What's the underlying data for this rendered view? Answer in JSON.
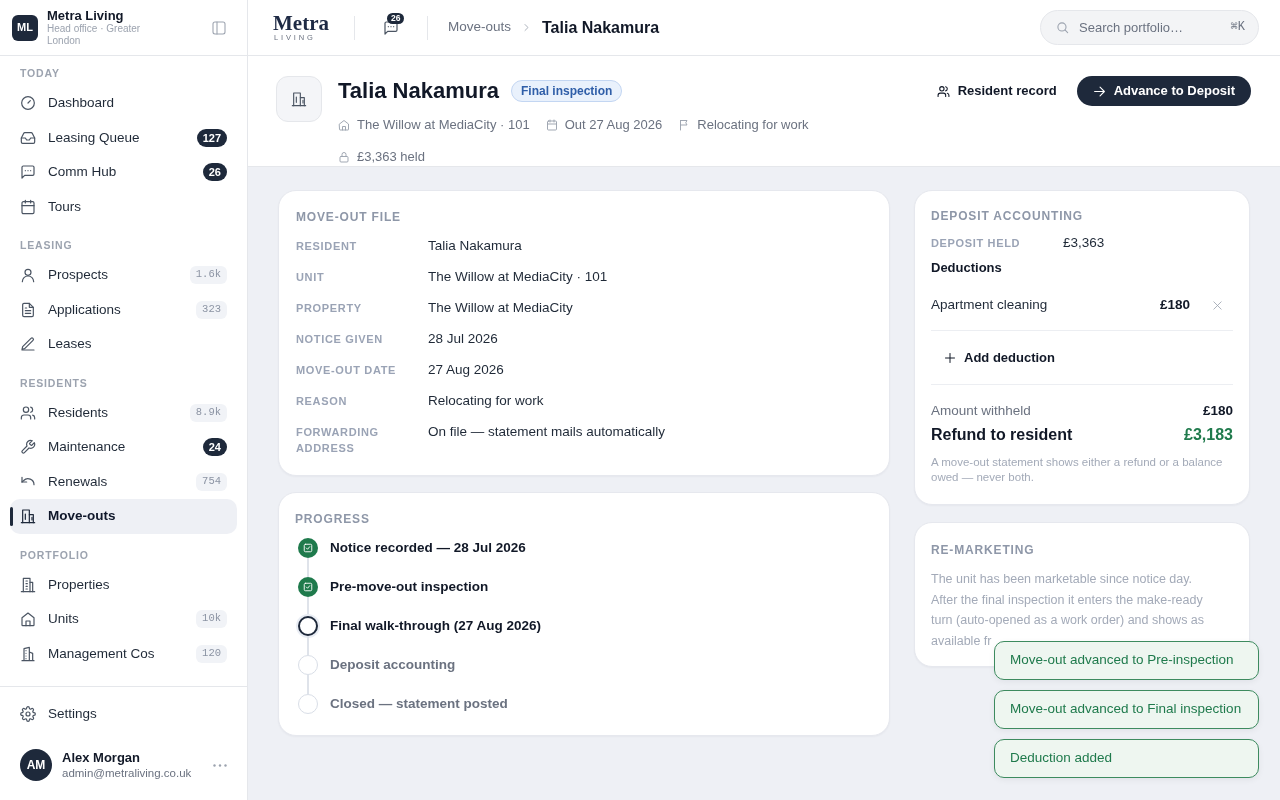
{
  "sidebar": {
    "brand": {
      "initials": "ML",
      "name": "Metra Living",
      "subtitle": "Head office · Greater London"
    },
    "sections": [
      {
        "label": "TODAY",
        "items": [
          {
            "label": "Dashboard",
            "selected": false
          },
          {
            "label": "Leasing Queue",
            "selected": false,
            "badge": {
              "text": "127",
              "kind": "unread"
            }
          },
          {
            "label": "Comm Hub",
            "selected": false,
            "badge": {
              "text": "26",
              "kind": "unread"
            }
          },
          {
            "label": "Tours",
            "selected": false
          }
        ]
      },
      {
        "label": "LEASING",
        "items": [
          {
            "label": "Prospects",
            "selected": false,
            "badge": {
              "text": "1.6k",
              "kind": "total"
            }
          },
          {
            "label": "Applications",
            "selected": false,
            "badge": {
              "text": "323",
              "kind": "total"
            }
          },
          {
            "label": "Leases",
            "selected": false
          }
        ]
      },
      {
        "label": "RESIDENTS",
        "items": [
          {
            "label": "Residents",
            "selected": false,
            "badge": {
              "text": "8.9k",
              "kind": "total"
            }
          },
          {
            "label": "Maintenance",
            "selected": false,
            "badge": {
              "text": "24",
              "kind": "unread"
            }
          },
          {
            "label": "Renewals",
            "selected": false,
            "badge": {
              "text": "754",
              "kind": "total"
            }
          },
          {
            "label": "Move-outs",
            "selected": true
          }
        ]
      },
      {
        "label": "PORTFOLIO",
        "items": [
          {
            "label": "Properties",
            "selected": false
          },
          {
            "label": "Units",
            "selected": false,
            "badge": {
              "text": "10k",
              "kind": "total"
            }
          },
          {
            "label": "Management Cos",
            "selected": false,
            "badge": {
              "text": "120",
              "kind": "total"
            }
          }
        ]
      }
    ],
    "settings": {
      "label": "Settings",
      "selected": false
    },
    "user": {
      "initials": "AM",
      "name": "Alex Morgan",
      "email": "admin@metraliving.co.uk"
    }
  },
  "top_bar": {
    "logo": {
      "name": "Metra",
      "tagline": "LIVING"
    },
    "messages_badge": "26",
    "breadcrumb": [
      "Move-outs",
      "Talia Nakamura"
    ],
    "search": {
      "placeholder": "Search portfolio…",
      "shortcut": "⌘K"
    }
  },
  "record_header": {
    "name": "Talia Nakamura",
    "status": "Final inspection",
    "meta": [
      "The Willow at MediaCity · 101",
      "Out 27 Aug 2026",
      "Relocating for work",
      "£3,363 held"
    ],
    "actions": [
      {
        "label": "Resident record",
        "kind": "secondary"
      },
      {
        "label": "Advance to Deposit",
        "kind": "primary"
      }
    ]
  },
  "move_out_file": {
    "title": "MOVE-OUT FILE",
    "rows": [
      {
        "label": "RESIDENT",
        "value": "Talia Nakamura"
      },
      {
        "label": "UNIT",
        "value": "The Willow at MediaCity · 101"
      },
      {
        "label": "PROPERTY",
        "value": "The Willow at MediaCity"
      },
      {
        "label": "NOTICE GIVEN",
        "value": "28 Jul 2026"
      },
      {
        "label": "MOVE-OUT DATE",
        "value": "27 Aug 2026"
      },
      {
        "label": "REASON",
        "value": "Relocating for work"
      },
      {
        "label": "FORWARDING ADDRESS",
        "value": "On file — statement mails automatically"
      }
    ]
  },
  "progress": {
    "title": "PROGRESS",
    "steps": [
      {
        "label": "Notice recorded — 28 Jul 2026",
        "done": true,
        "current": false
      },
      {
        "label": "Pre-move-out inspection",
        "done": true,
        "current": false
      },
      {
        "label": "Final walk-through (27 Aug 2026)",
        "done": false,
        "current": true
      },
      {
        "label": "Deposit accounting",
        "done": false,
        "current": false
      },
      {
        "label": "Closed — statement posted",
        "done": false,
        "current": false
      }
    ]
  },
  "deposit_accounting": {
    "title": "DEPOSIT ACCOUNTING",
    "held_label": "DEPOSIT HELD",
    "held_value": "£3,363",
    "deductions_title": "Deductions",
    "deductions": [
      {
        "label": "Apartment cleaning",
        "amount": "£180"
      }
    ],
    "add_label": "Add deduction",
    "summary": [
      {
        "label": "Amount withheld",
        "value": "£180",
        "kind": "subtotal"
      },
      {
        "label": "Refund to resident",
        "value": "£3,183",
        "kind": "total"
      }
    ],
    "note": "A move-out statement shows either a refund or a balance owed — never both."
  },
  "re_marketing": {
    "title": "RE-MARKETING",
    "lines": [
      "The unit has been marketable since notice day.",
      "After the final inspection it enters the make-ready turn (auto-opened as a work order) and shows as available fr"
    ]
  },
  "toasts": [
    {
      "message": "Move-out advanced to Pre-inspection"
    },
    {
      "message": "Move-out advanced to Final inspection"
    },
    {
      "message": "Deduction added"
    }
  ]
}
